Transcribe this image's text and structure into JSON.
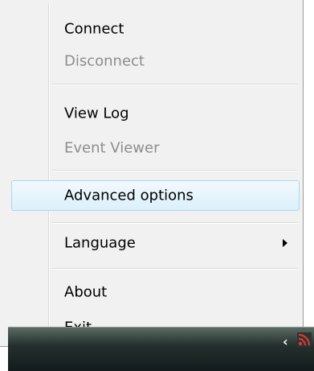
{
  "menu": {
    "items": [
      {
        "label": "Connect",
        "enabled": true,
        "highlighted": false,
        "submenu": false
      },
      {
        "label": "Disconnect",
        "enabled": false,
        "highlighted": false,
        "submenu": false
      },
      {
        "label": "View Log",
        "enabled": true,
        "highlighted": false,
        "submenu": false
      },
      {
        "label": "Event Viewer",
        "enabled": false,
        "highlighted": false,
        "submenu": false
      },
      {
        "label": "Advanced options",
        "enabled": true,
        "highlighted": true,
        "submenu": false
      },
      {
        "label": "Language",
        "enabled": true,
        "highlighted": false,
        "submenu": true
      },
      {
        "label": "About",
        "enabled": true,
        "highlighted": false,
        "submenu": false
      },
      {
        "label": "Exit",
        "enabled": true,
        "highlighted": false,
        "submenu": false
      }
    ]
  },
  "taskbar": {
    "tray_icons": [
      "chevron-left-icon",
      "network-signal-icon"
    ]
  },
  "colors": {
    "menu_background": "#f1f1f1",
    "disabled_text": "#8d8d8d",
    "highlight_border": "#a8d8eb",
    "tray_icon": "#d93a2b"
  }
}
